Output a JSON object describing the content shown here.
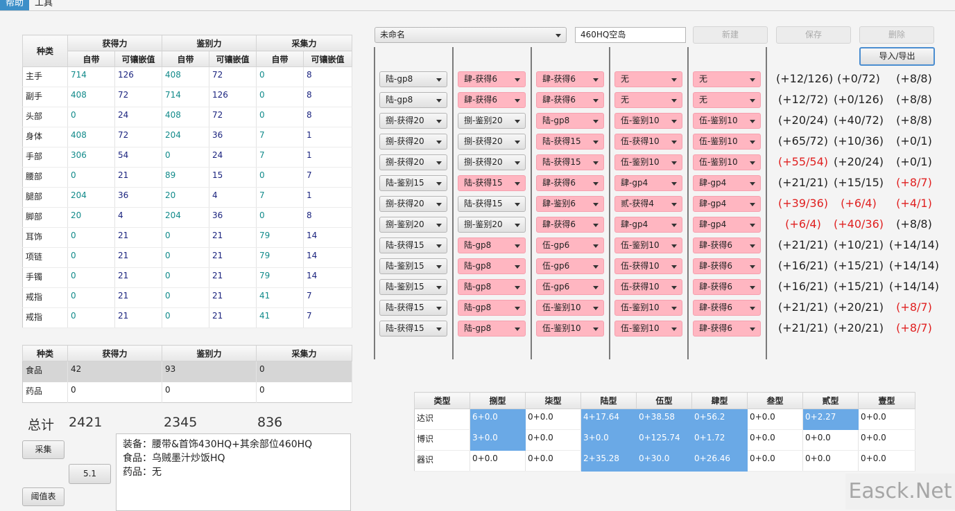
{
  "menu": {
    "items": [
      "帮助",
      "工具"
    ]
  },
  "equip_table": {
    "col_type": "种类",
    "groups": [
      "获得力",
      "鉴别力",
      "采集力"
    ],
    "sub": [
      "自带",
      "可镶嵌值"
    ],
    "rows": [
      {
        "name": "主手",
        "v": [
          "714",
          "126",
          "408",
          "72",
          "0",
          "8"
        ]
      },
      {
        "name": "副手",
        "v": [
          "408",
          "72",
          "714",
          "126",
          "0",
          "8"
        ]
      },
      {
        "name": "头部",
        "v": [
          "0",
          "24",
          "408",
          "72",
          "0",
          "8"
        ]
      },
      {
        "name": "身体",
        "v": [
          "408",
          "72",
          "204",
          "36",
          "7",
          "1"
        ]
      },
      {
        "name": "手部",
        "v": [
          "306",
          "54",
          "0",
          "24",
          "7",
          "1"
        ]
      },
      {
        "name": "腰部",
        "v": [
          "0",
          "21",
          "89",
          "15",
          "0",
          "7"
        ]
      },
      {
        "name": "腿部",
        "v": [
          "204",
          "36",
          "20",
          "4",
          "7",
          "1"
        ]
      },
      {
        "name": "脚部",
        "v": [
          "20",
          "4",
          "204",
          "36",
          "0",
          "8"
        ]
      },
      {
        "name": "耳饰",
        "v": [
          "0",
          "21",
          "0",
          "21",
          "79",
          "14"
        ]
      },
      {
        "name": "项链",
        "v": [
          "0",
          "21",
          "0",
          "21",
          "79",
          "14"
        ]
      },
      {
        "name": "手镯",
        "v": [
          "0",
          "21",
          "0",
          "21",
          "79",
          "14"
        ]
      },
      {
        "name": "戒指",
        "v": [
          "0",
          "21",
          "0",
          "21",
          "41",
          "7"
        ]
      },
      {
        "name": "戒指",
        "v": [
          "0",
          "21",
          "0",
          "21",
          "41",
          "7"
        ]
      }
    ]
  },
  "food_table": {
    "headers": [
      "种类",
      "获得力",
      "鉴别力",
      "采集力"
    ],
    "rows": [
      {
        "name": "食品",
        "v": [
          "42",
          "93",
          "0"
        ]
      },
      {
        "name": "药品",
        "v": [
          "0",
          "0",
          "0"
        ]
      }
    ]
  },
  "totals": {
    "label": "总计",
    "values": [
      "2421",
      "2345",
      "836"
    ]
  },
  "buttons": {
    "collect": "采集",
    "version": "5.1",
    "threshold": "阈值表",
    "new": "新建",
    "save": "保存",
    "delete": "删除",
    "import_export": "导入/导出"
  },
  "notes": [
    "装备：腰带&首饰430HQ+其余部位460HQ",
    "食品：乌贼墨汁炒饭HQ",
    "药品：无"
  ],
  "top": {
    "select_value": "未命名",
    "name_value": "460HQ空岛"
  },
  "materia_rows": [
    {
      "c": [
        {
          "t": "陆-gp8",
          "p": false
        },
        {
          "t": "肆-获得6",
          "p": true
        },
        {
          "t": "肆-获得6",
          "p": true
        },
        {
          "t": "无",
          "p": true
        },
        {
          "t": "无",
          "p": true
        }
      ],
      "r": [
        {
          "t": "(+12/126)",
          "red": false
        },
        {
          "t": "(+0/72)",
          "red": false
        },
        {
          "t": "(+8/8)",
          "red": false
        }
      ]
    },
    {
      "c": [
        {
          "t": "陆-gp8",
          "p": false
        },
        {
          "t": "肆-获得6",
          "p": true
        },
        {
          "t": "肆-获得6",
          "p": true
        },
        {
          "t": "无",
          "p": true
        },
        {
          "t": "无",
          "p": true
        }
      ],
      "r": [
        {
          "t": "(+12/72)",
          "red": false
        },
        {
          "t": "(+0/126)",
          "red": false
        },
        {
          "t": "(+8/8)",
          "red": false
        }
      ]
    },
    {
      "c": [
        {
          "t": "捌-获得20",
          "p": false
        },
        {
          "t": "捌-鉴别20",
          "p": false
        },
        {
          "t": "陆-gp8",
          "p": true
        },
        {
          "t": "伍-鉴别10",
          "p": true
        },
        {
          "t": "伍-鉴别10",
          "p": true
        }
      ],
      "r": [
        {
          "t": "(+20/24)",
          "red": false
        },
        {
          "t": "(+40/72)",
          "red": false
        },
        {
          "t": "(+8/8)",
          "red": false
        }
      ]
    },
    {
      "c": [
        {
          "t": "捌-获得20",
          "p": false
        },
        {
          "t": "捌-获得20",
          "p": false
        },
        {
          "t": "陆-获得15",
          "p": true
        },
        {
          "t": "伍-获得10",
          "p": true
        },
        {
          "t": "伍-鉴别10",
          "p": true
        }
      ],
      "r": [
        {
          "t": "(+65/72)",
          "red": false
        },
        {
          "t": "(+10/36)",
          "red": false
        },
        {
          "t": "(+0/1)",
          "red": false
        }
      ]
    },
    {
      "c": [
        {
          "t": "捌-获得20",
          "p": false
        },
        {
          "t": "捌-获得20",
          "p": false
        },
        {
          "t": "陆-获得15",
          "p": true
        },
        {
          "t": "伍-鉴别10",
          "p": true
        },
        {
          "t": "伍-鉴别10",
          "p": true
        }
      ],
      "r": [
        {
          "t": "(+55/54)",
          "red": true
        },
        {
          "t": "(+20/24)",
          "red": false
        },
        {
          "t": "(+0/1)",
          "red": false
        }
      ]
    },
    {
      "c": [
        {
          "t": "陆-鉴别15",
          "p": false
        },
        {
          "t": "陆-获得15",
          "p": true
        },
        {
          "t": "肆-获得6",
          "p": true
        },
        {
          "t": "肆-gp4",
          "p": true
        },
        {
          "t": "肆-gp4",
          "p": true
        }
      ],
      "r": [
        {
          "t": "(+21/21)",
          "red": false
        },
        {
          "t": "(+15/15)",
          "red": false
        },
        {
          "t": "(+8/7)",
          "red": true
        }
      ]
    },
    {
      "c": [
        {
          "t": "捌-获得20",
          "p": false
        },
        {
          "t": "陆-获得15",
          "p": false
        },
        {
          "t": "肆-鉴别6",
          "p": true
        },
        {
          "t": "贰-获得4",
          "p": true
        },
        {
          "t": "肆-gp4",
          "p": true
        }
      ],
      "r": [
        {
          "t": "(+39/36)",
          "red": true
        },
        {
          "t": "(+6/4)",
          "red": true
        },
        {
          "t": "(+4/1)",
          "red": true
        }
      ]
    },
    {
      "c": [
        {
          "t": "捌-鉴别20",
          "p": false
        },
        {
          "t": "捌-鉴别20",
          "p": false
        },
        {
          "t": "肆-获得6",
          "p": true
        },
        {
          "t": "肆-gp4",
          "p": true
        },
        {
          "t": "肆-gp4",
          "p": true
        }
      ],
      "r": [
        {
          "t": "(+6/4)",
          "red": true
        },
        {
          "t": "(+40/36)",
          "red": true
        },
        {
          "t": "(+8/8)",
          "red": false
        }
      ]
    },
    {
      "c": [
        {
          "t": "陆-获得15",
          "p": false
        },
        {
          "t": "陆-gp8",
          "p": true
        },
        {
          "t": "伍-gp6",
          "p": true
        },
        {
          "t": "伍-鉴别10",
          "p": true
        },
        {
          "t": "肆-获得6",
          "p": true
        }
      ],
      "r": [
        {
          "t": "(+21/21)",
          "red": false
        },
        {
          "t": "(+10/21)",
          "red": false
        },
        {
          "t": "(+14/14)",
          "red": false
        }
      ]
    },
    {
      "c": [
        {
          "t": "陆-鉴别15",
          "p": false
        },
        {
          "t": "陆-gp8",
          "p": true
        },
        {
          "t": "伍-gp6",
          "p": true
        },
        {
          "t": "伍-获得10",
          "p": true
        },
        {
          "t": "肆-获得6",
          "p": true
        }
      ],
      "r": [
        {
          "t": "(+16/21)",
          "red": false
        },
        {
          "t": "(+15/21)",
          "red": false
        },
        {
          "t": "(+14/14)",
          "red": false
        }
      ]
    },
    {
      "c": [
        {
          "t": "陆-鉴别15",
          "p": false
        },
        {
          "t": "陆-gp8",
          "p": true
        },
        {
          "t": "伍-gp6",
          "p": true
        },
        {
          "t": "伍-获得10",
          "p": true
        },
        {
          "t": "肆-获得6",
          "p": true
        }
      ],
      "r": [
        {
          "t": "(+16/21)",
          "red": false
        },
        {
          "t": "(+15/21)",
          "red": false
        },
        {
          "t": "(+14/14)",
          "red": false
        }
      ]
    },
    {
      "c": [
        {
          "t": "陆-获得15",
          "p": false
        },
        {
          "t": "陆-gp8",
          "p": true
        },
        {
          "t": "伍-鉴别10",
          "p": true
        },
        {
          "t": "伍-鉴别10",
          "p": true
        },
        {
          "t": "肆-获得6",
          "p": true
        }
      ],
      "r": [
        {
          "t": "(+21/21)",
          "red": false
        },
        {
          "t": "(+20/21)",
          "red": false
        },
        {
          "t": "(+8/7)",
          "red": true
        }
      ]
    },
    {
      "c": [
        {
          "t": "陆-获得15",
          "p": false
        },
        {
          "t": "陆-gp8",
          "p": true
        },
        {
          "t": "伍-鉴别10",
          "p": true
        },
        {
          "t": "伍-鉴别10",
          "p": true
        },
        {
          "t": "肆-获得6",
          "p": true
        }
      ],
      "r": [
        {
          "t": "(+21/21)",
          "red": false
        },
        {
          "t": "(+20/21)",
          "red": false
        },
        {
          "t": "(+8/7)",
          "red": true
        }
      ]
    }
  ],
  "materia_table": {
    "headers": [
      "类型",
      "捌型",
      "柒型",
      "陆型",
      "伍型",
      "肆型",
      "叁型",
      "贰型",
      "壹型"
    ],
    "rows": [
      {
        "name": "达识",
        "v": [
          {
            "t": "6+0.0",
            "hl": true
          },
          {
            "t": "0+0.0",
            "hl": false
          },
          {
            "t": "4+17.64",
            "hl": true
          },
          {
            "t": "0+38.58",
            "hl": true
          },
          {
            "t": "0+56.2",
            "hl": true
          },
          {
            "t": "0+0.0",
            "hl": false
          },
          {
            "t": "0+2.27",
            "hl": true
          },
          {
            "t": "0+0.0",
            "hl": false
          }
        ]
      },
      {
        "name": "博识",
        "v": [
          {
            "t": "3+0.0",
            "hl": true
          },
          {
            "t": "0+0.0",
            "hl": false
          },
          {
            "t": "3+0.0",
            "hl": true
          },
          {
            "t": "0+125.74",
            "hl": true
          },
          {
            "t": "0+1.72",
            "hl": true
          },
          {
            "t": "0+0.0",
            "hl": false
          },
          {
            "t": "0+0.0",
            "hl": false
          },
          {
            "t": "0+0.0",
            "hl": false
          }
        ]
      },
      {
        "name": "器识",
        "v": [
          {
            "t": "0+0.0",
            "hl": false
          },
          {
            "t": "0+0.0",
            "hl": false
          },
          {
            "t": "2+35.28",
            "hl": true
          },
          {
            "t": "0+30.0",
            "hl": true
          },
          {
            "t": "0+26.46",
            "hl": true
          },
          {
            "t": "0+0.0",
            "hl": false
          },
          {
            "t": "0+0.0",
            "hl": false
          },
          {
            "t": "0+0.0",
            "hl": false
          }
        ]
      }
    ]
  },
  "watermark": "Easck.Net"
}
